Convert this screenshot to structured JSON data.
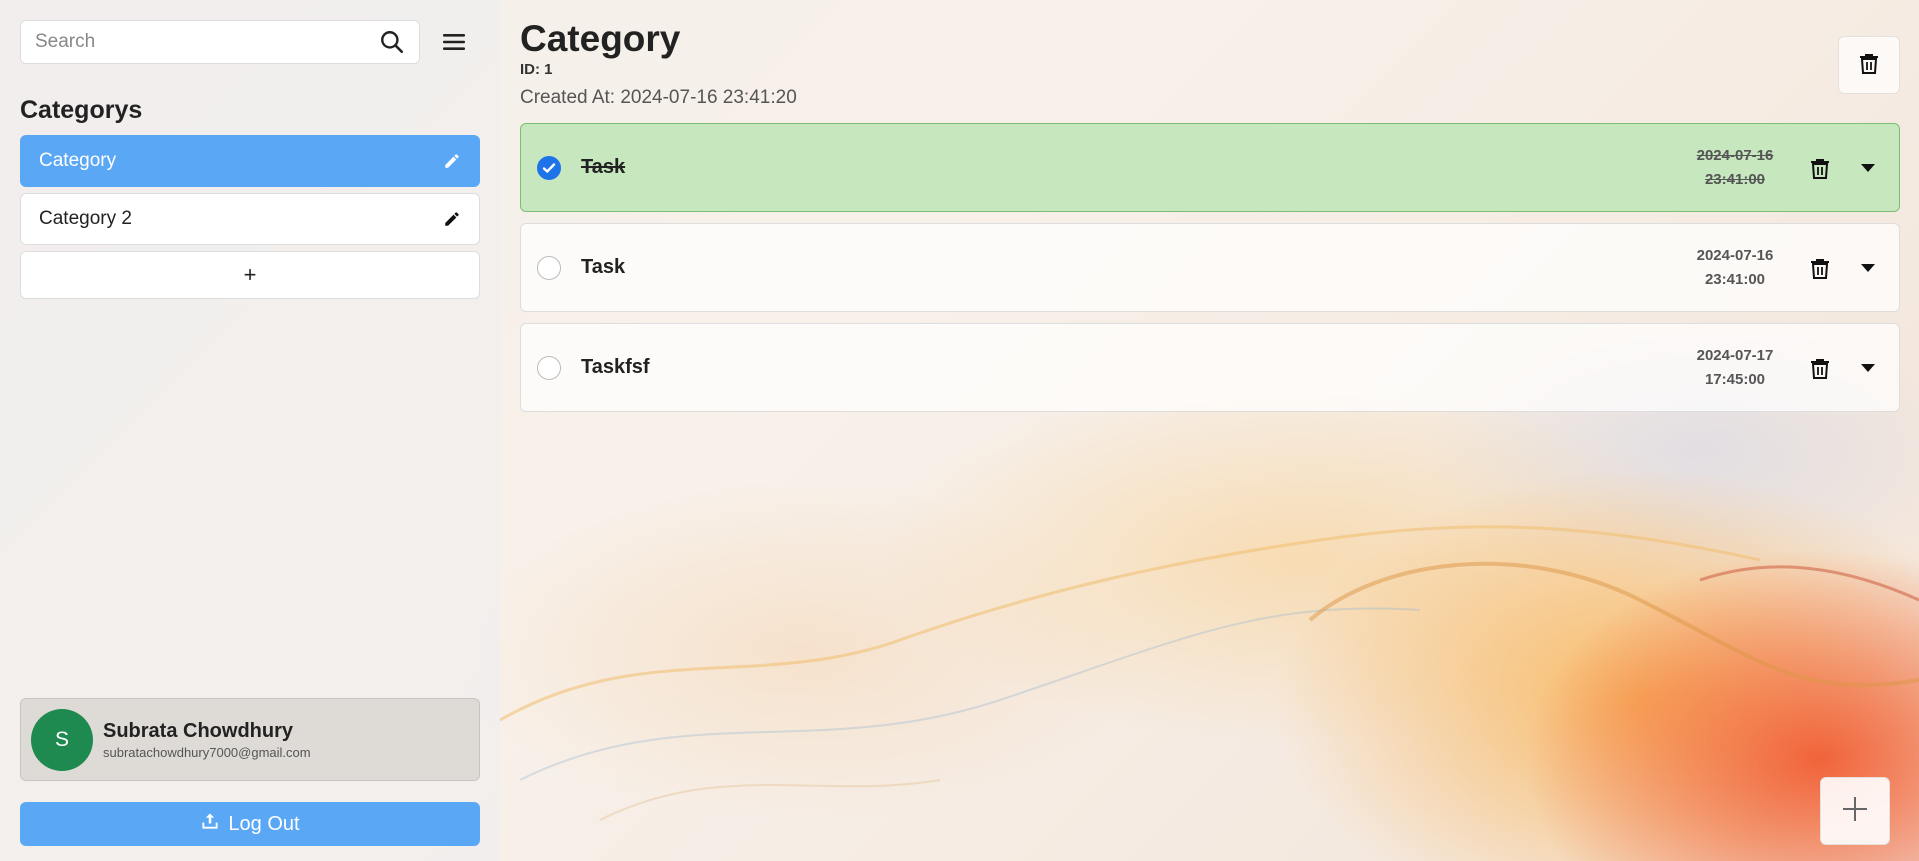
{
  "search": {
    "placeholder": "Search"
  },
  "sidebar": {
    "section_title": "Categorys",
    "categories": [
      {
        "label": "Category",
        "active": true
      },
      {
        "label": "Category 2",
        "active": false
      }
    ],
    "add_label": "+"
  },
  "user": {
    "initial": "S",
    "name": "Subrata Chowdhury",
    "email": "subratachowdhury7000@gmail.com"
  },
  "logout": {
    "label": "Log Out"
  },
  "main": {
    "title": "Category",
    "id_label": "ID: 1",
    "created_label": "Created At: 2024-07-16 23:41:20"
  },
  "tasks": [
    {
      "title": "Task",
      "date": "2024-07-16",
      "time": "23:41:00",
      "completed": true
    },
    {
      "title": "Task",
      "date": "2024-07-16",
      "time": "23:41:00",
      "completed": false
    },
    {
      "title": "Taskfsf",
      "date": "2024-07-17",
      "time": "17:45:00",
      "completed": false
    }
  ],
  "colors": {
    "accent": "#5aa8f5",
    "check": "#1e73e8",
    "done_bg": "#c7e8bf",
    "avatar": "#1e8a4f"
  },
  "icons": [
    "search-icon",
    "menu-icon",
    "pencil-icon",
    "trash-icon",
    "chevron-down-icon",
    "upload-icon",
    "plus-icon",
    "checkmark-icon"
  ]
}
